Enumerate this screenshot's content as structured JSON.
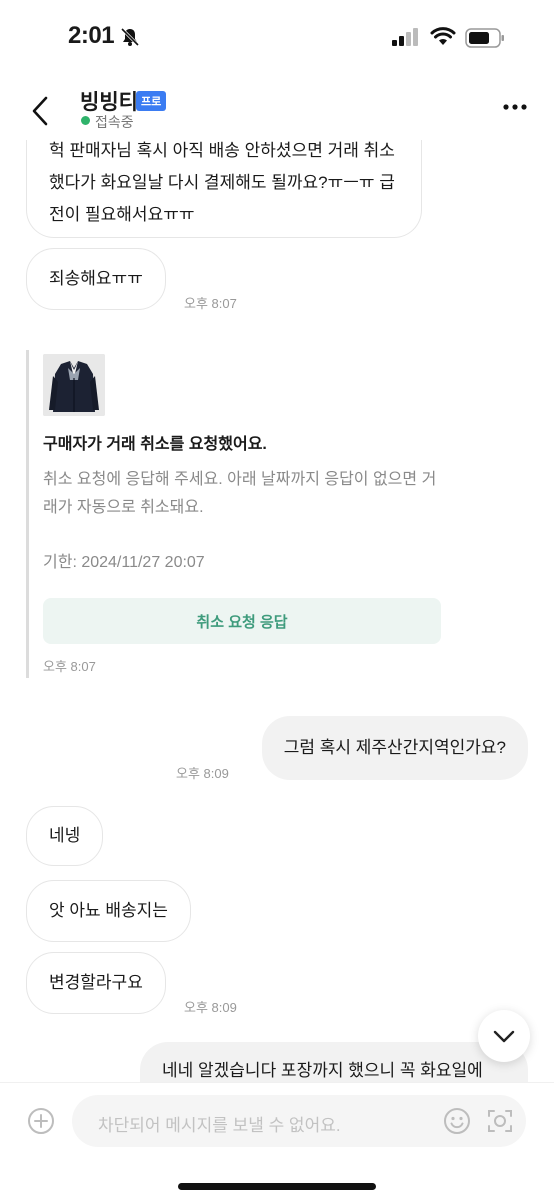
{
  "status_bar": {
    "time": "2:01"
  },
  "header": {
    "name": "빙빙티",
    "badge": "프로",
    "status": "접속중"
  },
  "messages": {
    "m1": {
      "text": "헉 판매자님 혹시 아직 배송 안하셨으면 거래 취소 했다가 화요일날 다시 결제해도 될까요?ㅠㅡㅠ 급전이 필요해서요ㅠㅠ"
    },
    "m2": {
      "text": "죄송해요ㅠㅠ",
      "time": "오후 8:07"
    },
    "m3": {
      "text": "그럼 혹시 제주산간지역인가요?",
      "time": "오후 8:09"
    },
    "m4": {
      "text": "네넹"
    },
    "m5": {
      "text": "앗 아뇨 배송지는"
    },
    "m6": {
      "text": "변경할라구요",
      "time": "오후 8:09"
    },
    "m7": {
      "text": "네네 알겠습니다 포장까지 했으니 꼭 화요일에"
    }
  },
  "system_card": {
    "title": "구매자가 거래 취소를 요청했어요.",
    "description": "취소 요청에 응답해 주세요. 아래 날짜까지 응답이 없으면 거래가 자동으로 취소돼요.",
    "deadline": "기한: 2024/11/27 20:07",
    "button_label": "취소 요청 응답",
    "time": "오후 8:07"
  },
  "input": {
    "placeholder": "차단되어 메시지를 보낼 수 없어요."
  },
  "colors": {
    "accent_green": "#3e9b7c",
    "online_green": "#2fb36b",
    "pro_badge_blue": "#3b7cf2"
  },
  "icons": [
    "bell-slash-icon",
    "signal-icon",
    "wifi-icon",
    "battery-icon",
    "back-arrow-icon",
    "more-icon",
    "chevron-down-icon",
    "plus-icon",
    "emoji-icon",
    "camera-icon"
  ]
}
